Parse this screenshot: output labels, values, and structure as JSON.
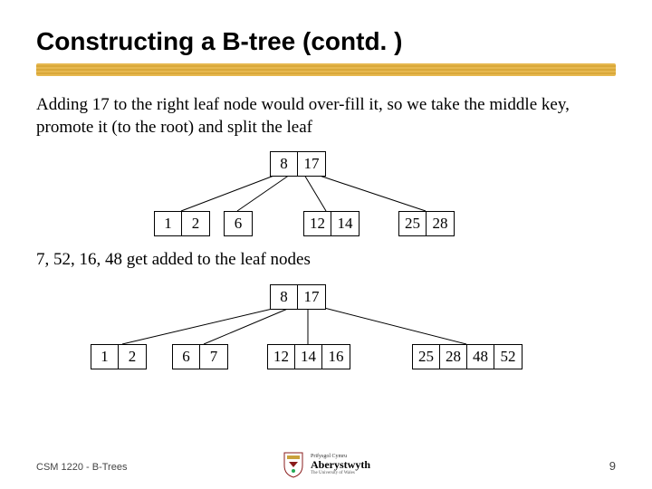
{
  "title": "Constructing a B-tree (contd. )",
  "para1": "Adding 17 to the right leaf node would over-fill it, so we take the middle key, promote it (to the root) and split the leaf",
  "para2": "7, 52, 16, 48 get added to the leaf nodes",
  "tree1": {
    "root": [
      "8",
      "17"
    ],
    "leaves": [
      [
        "1",
        "2"
      ],
      [
        "6"
      ],
      [
        "12",
        "14"
      ],
      [
        "25",
        "28"
      ]
    ]
  },
  "tree2": {
    "root": [
      "8",
      "17"
    ],
    "leaves": [
      [
        "1",
        "2"
      ],
      [
        "6",
        "7"
      ],
      [
        "12",
        "14",
        "16"
      ],
      [
        "25",
        "28",
        "48",
        "52"
      ]
    ]
  },
  "footer": "CSM 1220 - B-Trees",
  "page_num": "9",
  "logo": {
    "small": "Prifysgol Cymru",
    "big": "Aberystwyth",
    "sub": "The University of Wales"
  }
}
